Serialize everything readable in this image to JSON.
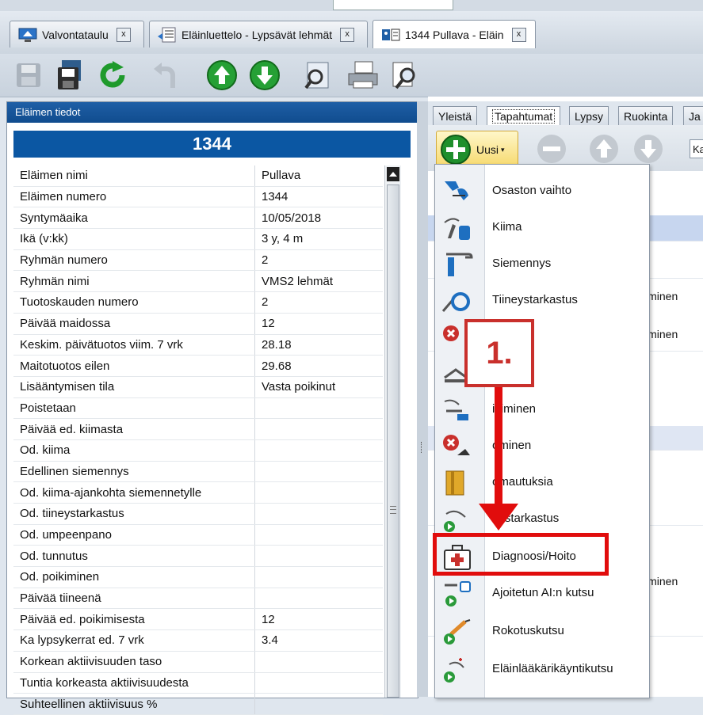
{
  "tabs": [
    {
      "label": "Valvontataulu",
      "close": "x",
      "icon": "dashboard-icon"
    },
    {
      "label": "Eläinluettelo - Lypsävät lehmät",
      "close": "x",
      "icon": "list-icon"
    },
    {
      "label": "1344 Pullava - Eläin",
      "close": "x",
      "icon": "animal-card-icon"
    }
  ],
  "toolbar": {
    "buttons": [
      "save-icon",
      "save-all-icon",
      "refresh-icon",
      "undo-icon",
      "up-icon",
      "down-icon",
      "report-icon",
      "print-icon",
      "preview-icon"
    ]
  },
  "left_panel": {
    "header": "Eläimen tiedot",
    "number": "1344",
    "rows": [
      {
        "label": "Eläimen nimi",
        "value": "Pullava"
      },
      {
        "label": "Eläimen numero",
        "value": "1344"
      },
      {
        "label": "Syntymäaika",
        "value": "10/05/2018"
      },
      {
        "label": "Ikä (v:kk)",
        "value": "3 y, 4 m"
      },
      {
        "label": "Ryhmän numero",
        "value": "2"
      },
      {
        "label": "Ryhmän nimi",
        "value": "VMS2 lehmät"
      },
      {
        "label": "Tuotoskauden numero",
        "value": "2"
      },
      {
        "label": "Päivää maidossa",
        "value": "12"
      },
      {
        "label": "Keskim. päivätuotos viim. 7 vrk",
        "value": "28.18"
      },
      {
        "label": "Maitotuotos eilen",
        "value": "29.68"
      },
      {
        "label": "Lisääntymisen tila",
        "value": "Vasta poikinut"
      },
      {
        "label": "Poistetaan",
        "value": ""
      },
      {
        "label": "Päivää ed. kiimasta",
        "value": ""
      },
      {
        "label": "Od. kiima",
        "value": ""
      },
      {
        "label": "Edellinen siemennys",
        "value": ""
      },
      {
        "label": "Od. kiima-ajankohta siemennetylle",
        "value": ""
      },
      {
        "label": "Od. tiineystarkastus",
        "value": ""
      },
      {
        "label": "Od. umpeenpano",
        "value": ""
      },
      {
        "label": "Od. tunnutus",
        "value": ""
      },
      {
        "label": "Od. poikiminen",
        "value": ""
      },
      {
        "label": "Päivää tiineenä",
        "value": ""
      },
      {
        "label": "Päivää ed. poikimisesta",
        "value": "12"
      },
      {
        "label": "Ka lypsykerrat ed. 7 vrk",
        "value": "3.4"
      },
      {
        "label": "Korkean aktiivisuuden taso",
        "value": ""
      },
      {
        "label": "Tuntia korkeasta aktiivisuudesta",
        "value": ""
      },
      {
        "label": "Suhteellinen aktiivisuus %",
        "value": ""
      }
    ]
  },
  "right_panel": {
    "tabs": [
      "Yleistä",
      "Tapahtumat",
      "Lypsy",
      "Ruokinta",
      "Ja"
    ],
    "active_tab": "Tapahtumat",
    "new_button": "Uusi",
    "combo_value": "Ka",
    "background_texts": [
      "iminen",
      "iminen",
      "iminen"
    ]
  },
  "menu": {
    "items": [
      {
        "label": "Osaston vaihto",
        "icon": "transfer-icon"
      },
      {
        "label": "Kiima",
        "icon": "heat-icon"
      },
      {
        "label": "Siemennys",
        "icon": "insemination-icon"
      },
      {
        "label": "Tiineystarkastus",
        "icon": "pregnancy-check-icon"
      },
      {
        "label": "mpano",
        "icon": "dry-off-icon"
      },
      {
        "label": "us",
        "icon": "tuning-icon"
      },
      {
        "label": "ikiminen",
        "icon": "calving-icon"
      },
      {
        "label": "ominen",
        "icon": "removal-icon"
      },
      {
        "label": "omautuksia",
        "icon": "notes-icon"
      },
      {
        "label": "eystarkastus",
        "icon": "check-schedule-icon"
      },
      {
        "label": "Diagnoosi/Hoito",
        "icon": "medical-kit-icon"
      },
      {
        "label": "Ajoitetun AI:n kutsu",
        "icon": "timed-ai-icon"
      },
      {
        "label": "Rokotuskutsu",
        "icon": "vaccination-icon"
      },
      {
        "label": "Eläinlääkärikäyntikutsu",
        "icon": "vet-visit-icon"
      }
    ]
  },
  "annotation": {
    "step": "1."
  },
  "colors": {
    "accent": "#0b57a3",
    "annotation_red": "#e10d0d"
  }
}
